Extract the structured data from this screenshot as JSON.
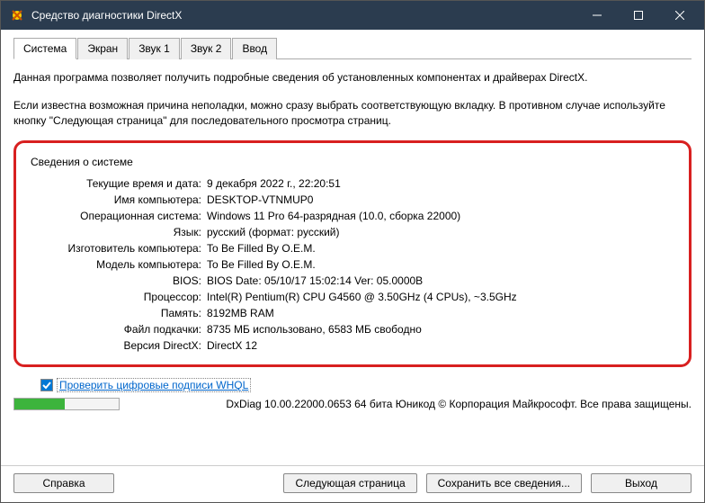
{
  "window": {
    "title": "Средство диагностики DirectX"
  },
  "tabs": {
    "system": "Система",
    "display": "Экран",
    "sound1": "Звук 1",
    "sound2": "Звук 2",
    "input": "Ввод"
  },
  "intro": {
    "p1": "Данная программа позволяет получить подробные сведения об установленных компонентах и драйверах DirectX.",
    "p2": "Если известна возможная причина неполадки, можно сразу выбрать соответствующую вкладку. В противном случае используйте кнопку \"Следующая страница\" для последовательного просмотра страниц."
  },
  "group": {
    "title": "Сведения о системе",
    "labels": {
      "datetime": "Текущие время и дата:",
      "computer": "Имя компьютера:",
      "os": "Операционная система:",
      "lang": "Язык:",
      "manufacturer": "Изготовитель компьютера:",
      "model": "Модель компьютера:",
      "bios": "BIOS:",
      "cpu": "Процессор:",
      "ram": "Память:",
      "pagefile": "Файл подкачки:",
      "dx": "Версия DirectX:"
    },
    "values": {
      "datetime": "9 декабря 2022 г., 22:20:51",
      "computer": "DESKTOP-VTNMUP0",
      "os": "Windows 11 Pro 64-разрядная (10.0, сборка 22000)",
      "lang": "русский (формат: русский)",
      "manufacturer": "To Be Filled By O.E.M.",
      "model": "To Be Filled By O.E.M.",
      "bios": "BIOS Date: 05/10/17 15:02:14 Ver: 05.0000B",
      "cpu": "Intel(R) Pentium(R) CPU G4560 @ 3.50GHz (4 CPUs), ~3.5GHz",
      "ram": "8192MB RAM",
      "pagefile": "8735 МБ использовано, 6583 МБ свободно",
      "dx": "DirectX 12"
    }
  },
  "whql": {
    "label": "Проверить цифровые подписи WHQL"
  },
  "status": {
    "text": "DxDiag 10.00.22000.0653 64 бита Юникод © Корпорация Майкрософт. Все права защищены."
  },
  "buttons": {
    "help": "Справка",
    "next": "Следующая страница",
    "save": "Сохранить все сведения...",
    "exit": "Выход"
  }
}
